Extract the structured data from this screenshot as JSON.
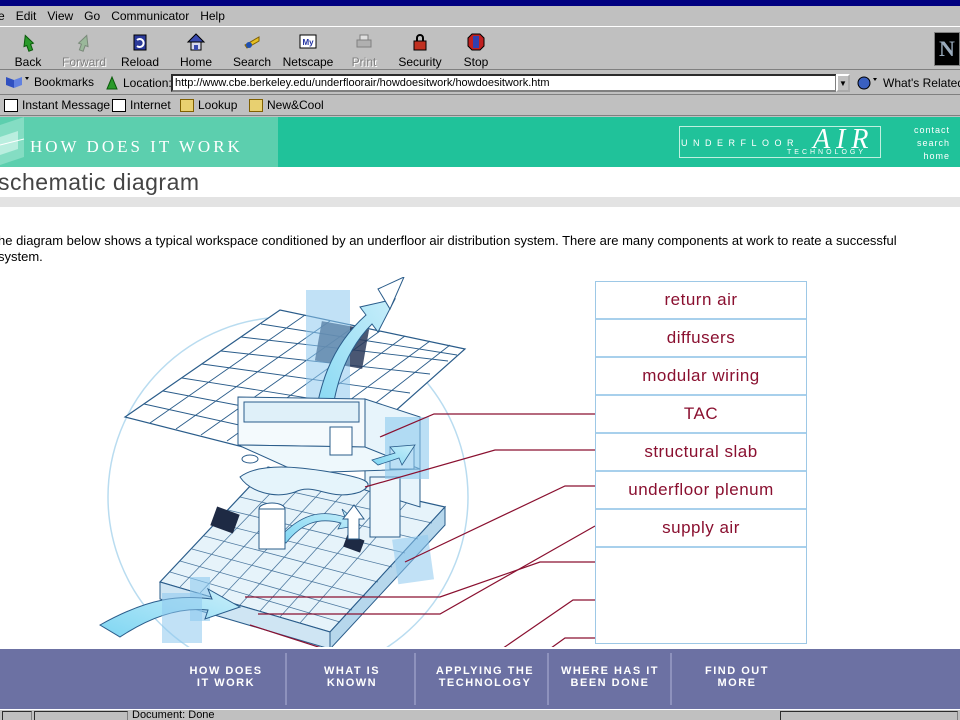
{
  "menu": [
    "e",
    "Edit",
    "View",
    "Go",
    "Communicator",
    "Help"
  ],
  "toolbar": {
    "back": "Back",
    "forward": "Forward",
    "reload": "Reload",
    "home": "Home",
    "search": "Search",
    "netscape": "Netscape",
    "print": "Print",
    "security": "Security",
    "stop": "Stop"
  },
  "location": {
    "bookmarks": "Bookmarks",
    "label": "Location:",
    "url": "http://www.cbe.berkeley.edu/underfloorair/howdoesitwork/howdoesitwork.htm",
    "related": "What's Related"
  },
  "personal": {
    "instant_message": "Instant Message",
    "internet": "Internet",
    "lookup": "Lookup",
    "newcool": "New&Cool"
  },
  "banner": {
    "title": "HOW DOES IT WORK",
    "logo_under": "UNDERFLOOR",
    "logo_air": "AIR",
    "logo_tech": "TECHNOLOGY",
    "links": [
      "contact",
      "search",
      "home"
    ]
  },
  "page": {
    "heading": "schematic diagram",
    "intro": "he diagram below shows a typical workspace conditioned by an underfloor air distribution system. There are many components at work to reate a successful system."
  },
  "components": [
    "return air",
    "diffusers",
    "modular wiring",
    "TAC",
    "structural slab",
    "underfloor plenum",
    "supply air"
  ],
  "nav": [
    "HOW DOES\nIT WORK",
    "WHAT IS\nKNOWN",
    "APPLYING THE\nTECHNOLOGY",
    "WHERE HAS IT\nBEEN DONE",
    "FIND OUT\nMORE"
  ],
  "status": {
    "text": "Document: Done"
  },
  "colors": {
    "banner": "#20c29a",
    "component_text": "#8a1030",
    "leader_line": "#8a1030",
    "diagram_blue": "#9dc8e6",
    "nav_bg": "#6c71a3"
  }
}
